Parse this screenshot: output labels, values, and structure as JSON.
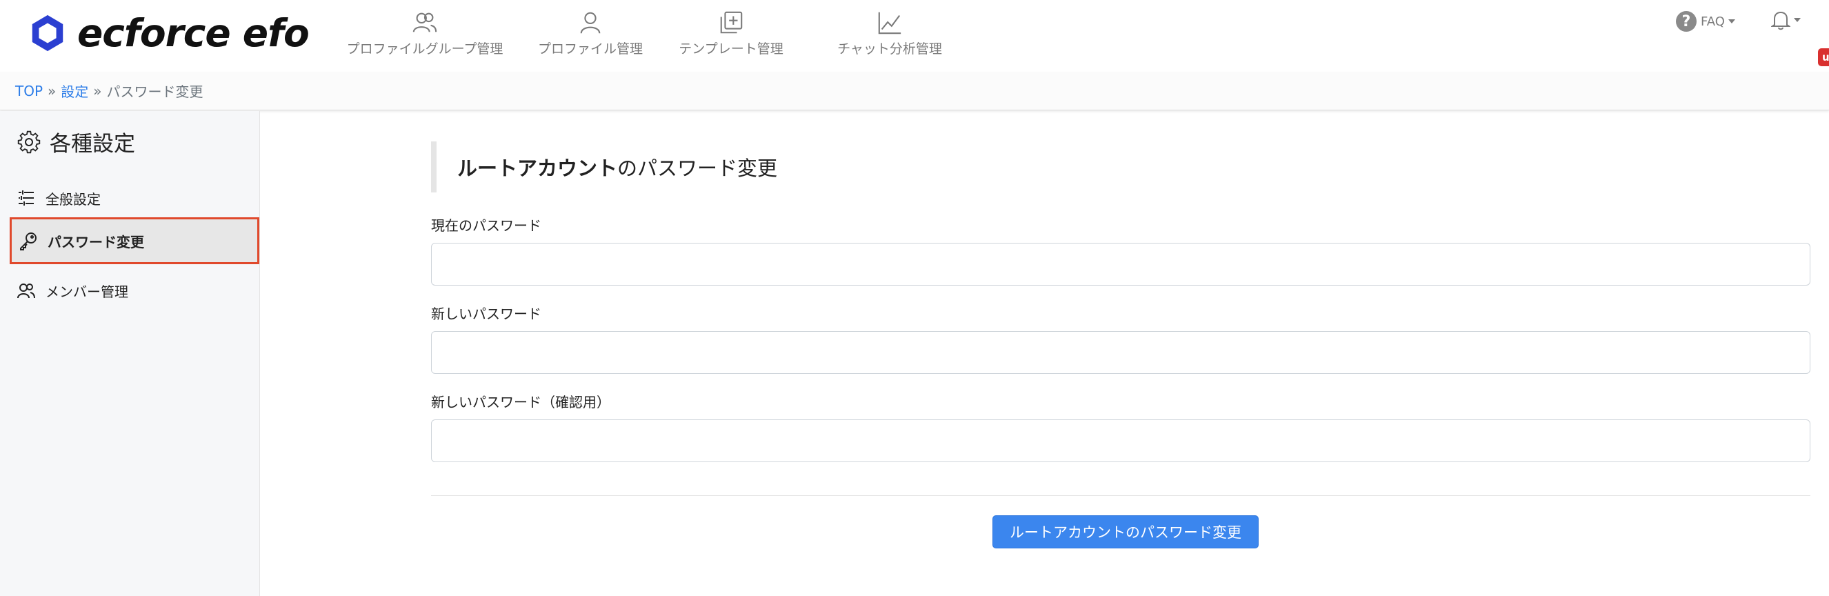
{
  "app": {
    "brand": "ecforce efo",
    "brand_color": "#2b3fd1"
  },
  "nav": {
    "items": [
      {
        "label": "プロファイルグループ管理",
        "icon": "users-icon"
      },
      {
        "label": "プロファイル管理",
        "icon": "user-icon"
      },
      {
        "label": "テンプレート管理",
        "icon": "add-square-icon"
      },
      {
        "label": "チャット分析管理",
        "icon": "line-chart-icon"
      }
    ],
    "faq_label": "FAQ",
    "notification_badge": "u"
  },
  "breadcrumb": {
    "top": "TOP",
    "settings": "設定",
    "current": "パスワード変更",
    "separator": "»"
  },
  "sidebar": {
    "title": "各種設定",
    "items": [
      {
        "label": "全般設定",
        "icon": "sliders-list-icon"
      },
      {
        "label": "パスワード変更",
        "icon": "key-icon",
        "active": true
      },
      {
        "label": "メンバー管理",
        "icon": "users-icon"
      }
    ]
  },
  "form": {
    "heading_strong": "ルートアカウント",
    "heading_rest": "のパスワード変更",
    "current_password_label": "現在のパスワード",
    "current_password_value": "",
    "new_password_label": "新しいパスワード",
    "new_password_value": "",
    "confirm_password_label": "新しいパスワード（確認用）",
    "confirm_password_value": "",
    "submit_label": "ルートアカウントのパスワード変更"
  },
  "colors": {
    "accent": "#3b86ee",
    "link": "#2e7ee8",
    "active_border": "#e0492c",
    "badge": "#d9302f"
  }
}
